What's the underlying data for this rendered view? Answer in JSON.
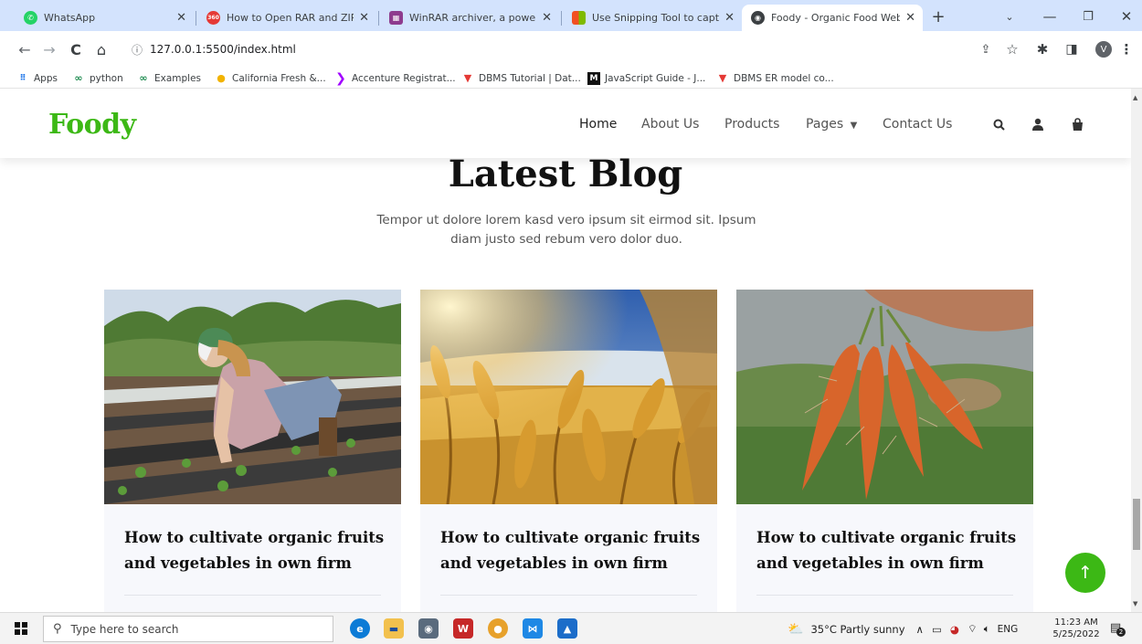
{
  "browser": {
    "tabs": [
      {
        "title": "WhatsApp",
        "fav_color": "#25d366",
        "fav_glyph": "✆",
        "icon": "whatsapp-icon"
      },
      {
        "title": "How to Open RAR and ZIP Fi",
        "fav_color": "#e53935",
        "fav_glyph": "360",
        "icon": "guide-site-icon"
      },
      {
        "title": "WinRAR archiver, a powerful",
        "fav_color": "#8e3b8e",
        "fav_glyph": "▦",
        "icon": "winrar-icon"
      },
      {
        "title": "Use Snipping Tool to capture",
        "fav_color": "#f25022",
        "fav_glyph": "▪",
        "icon": "microsoft-icon"
      },
      {
        "title": "Foody - Organic Food Websi",
        "fav_color": "#3c4043",
        "fav_glyph": "◉",
        "icon": "globe-icon"
      }
    ],
    "url": "127.0.0.1:5500/index.html",
    "profile_initial": "V",
    "bookmarks": [
      {
        "label": "Apps",
        "glyph": "⋮⋮",
        "color": "#1a73e8"
      },
      {
        "label": "python",
        "glyph": "∞",
        "color": "#1d8b4f"
      },
      {
        "label": "Examples",
        "glyph": "∞",
        "color": "#1d8b4f"
      },
      {
        "label": "California Fresh &...",
        "glyph": "●",
        "color": "#f2b300"
      },
      {
        "label": "Accenture Registrat...",
        "glyph": "❯",
        "color": "#a100ff"
      },
      {
        "label": "DBMS Tutorial | Dat...",
        "glyph": "▼",
        "color": "#e53935"
      },
      {
        "label": "JavaScript Guide - J...",
        "glyph": "M",
        "color": "#111111"
      },
      {
        "label": "DBMS ER model co...",
        "glyph": "▼",
        "color": "#e53935"
      }
    ]
  },
  "site": {
    "brand": "Foody",
    "brand_color": "#3cb815",
    "menu": [
      "Home",
      "About Us",
      "Products",
      "Pages",
      "Contact Us"
    ],
    "blog": {
      "title": "Latest Blog",
      "subtitle": "Tempor ut dolore lorem kasd vero ipsum sit eirmod sit. Ipsum diam justo sed rebum vero dolor duo.",
      "posts": [
        {
          "title": "How to cultivate organic fruits and vegetables in own firm"
        },
        {
          "title": "How to cultivate organic fruits and vegetables in own firm"
        },
        {
          "title": "How to cultivate organic fruits and vegetables in own firm"
        }
      ]
    }
  },
  "taskbar": {
    "search_placeholder": "Type here to search",
    "weather": "35°C  Partly sunny",
    "language": "ENG",
    "time": "11:23 AM",
    "date": "5/25/2022",
    "notification_count": "2"
  }
}
